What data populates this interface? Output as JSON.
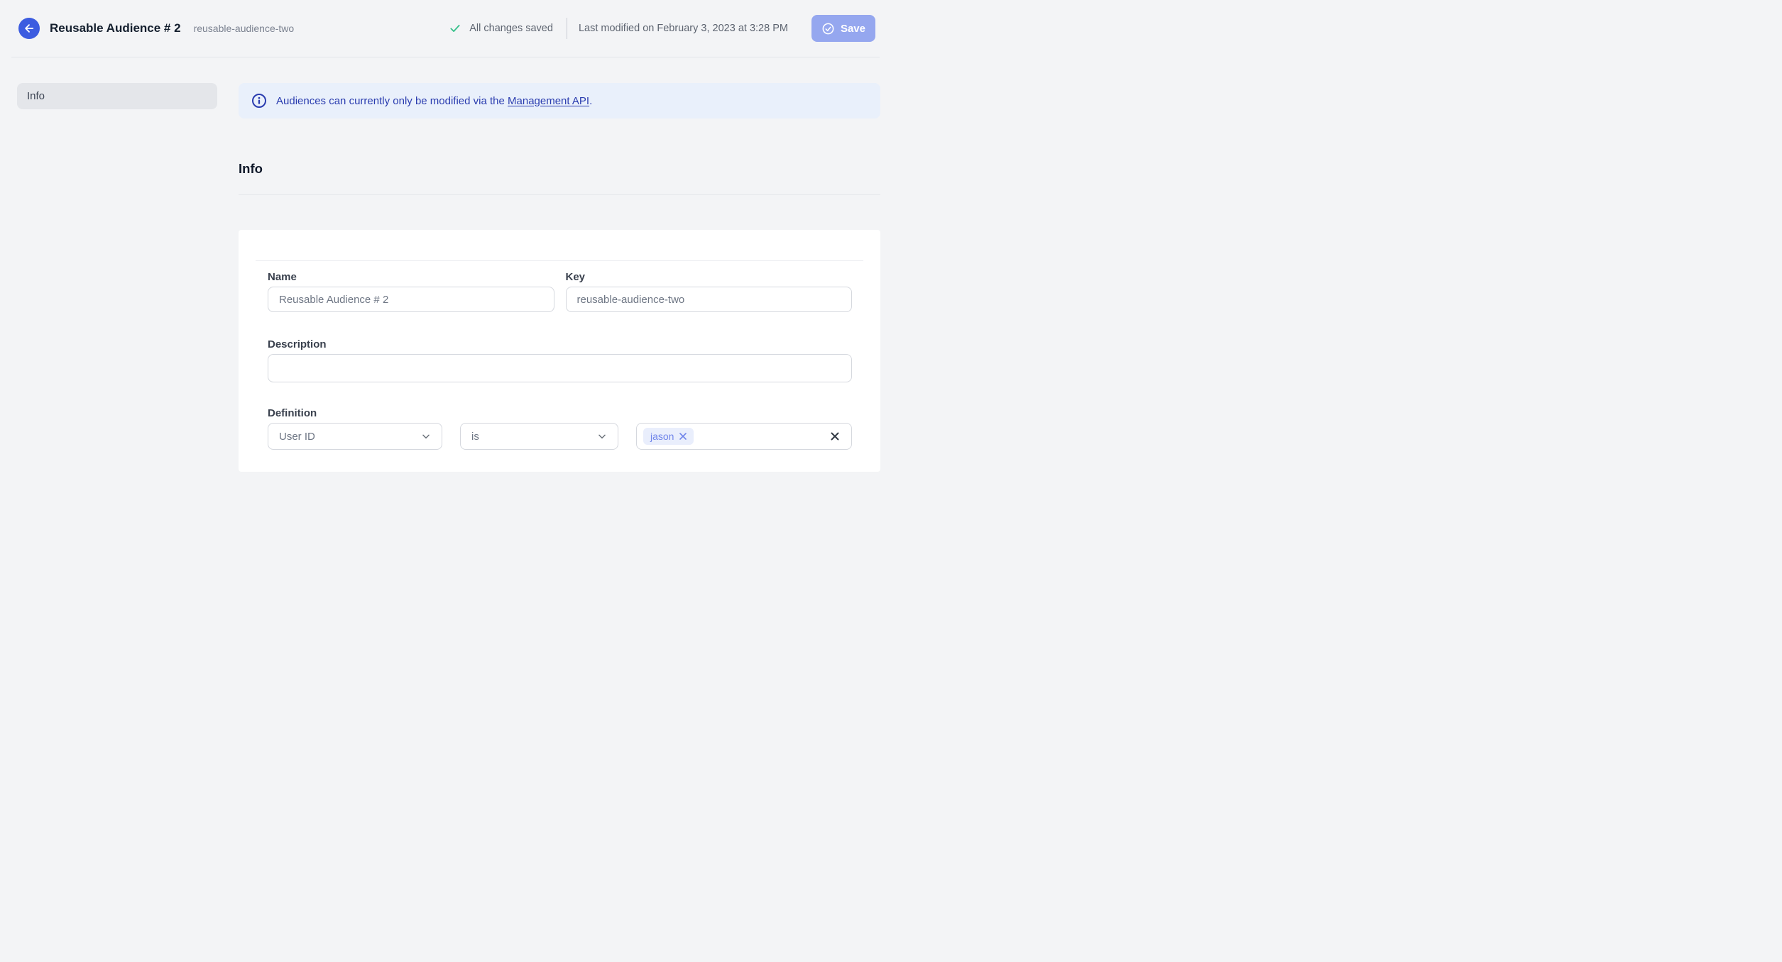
{
  "header": {
    "title": "Reusable Audience # 2",
    "subtitle": "reusable-audience-two",
    "status": "All changes saved",
    "last_modified": "Last modified on February 3, 2023 at 3:28 PM",
    "save_label": "Save"
  },
  "sidebar": {
    "items": [
      {
        "label": "Info"
      }
    ]
  },
  "banner": {
    "text_before": "Audiences can currently only be modified via the ",
    "link_label": "Management API",
    "text_after": "."
  },
  "section": {
    "title": "Info"
  },
  "form": {
    "name": {
      "label": "Name",
      "value": "Reusable Audience # 2"
    },
    "key": {
      "label": "Key",
      "value": "reusable-audience-two"
    },
    "description": {
      "label": "Description",
      "value": ""
    },
    "definition": {
      "label": "Definition",
      "field": "User ID",
      "operator": "is",
      "tags": [
        "jason"
      ]
    }
  },
  "colors": {
    "accent_blue": "#3c5ce0",
    "save_disabled_blue": "#95a7ef",
    "banner_bg": "#e9f0fb",
    "banner_text": "#2a3caf",
    "status_green": "#36c08a",
    "tag_bg": "#e9eefc",
    "tag_text": "#7085ea",
    "page_bg": "#f3f4f6"
  }
}
